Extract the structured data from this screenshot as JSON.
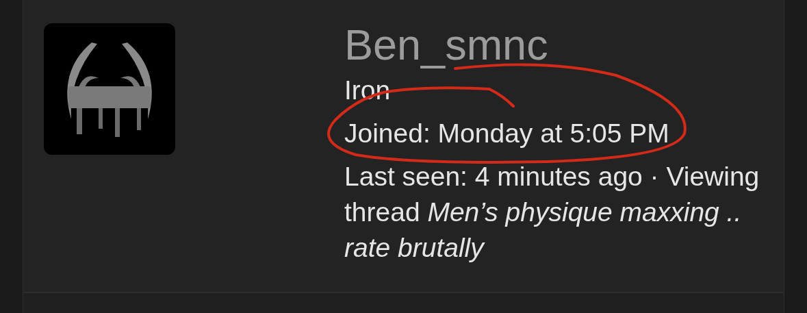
{
  "profile": {
    "username": "Ben_smnc",
    "user_title": "Iron",
    "joined": "Joined: Monday at 5:05 PM",
    "activity": "Last seen: 4 minutes ago · Viewing thread *Men’s physique maxxing .. rate brutally*"
  }
}
